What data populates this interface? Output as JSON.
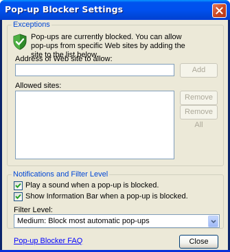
{
  "window": {
    "title": "Pop-up Blocker Settings",
    "titlebar_color": "#0054e3"
  },
  "exceptions": {
    "legend": "Exceptions",
    "description": "Pop-ups are currently blocked.  You can allow pop-ups from specific Web sites by adding the site to the list below.",
    "address_label": "Address of Web site to allow:",
    "address_value": "",
    "add_button": "Add",
    "allowed_sites_label": "Allowed sites:",
    "allowed_sites": [],
    "remove_button": "Remove",
    "remove_all_button": "Remove All"
  },
  "notifications": {
    "legend": "Notifications and Filter Level",
    "play_sound_label": "Play a sound when a pop-up is blocked.",
    "play_sound_checked": true,
    "info_bar_label": "Show Information Bar when a pop-up is blocked.",
    "info_bar_checked": true,
    "filter_level_label": "Filter Level:",
    "filter_level_value": "Medium: Block most automatic pop-ups"
  },
  "footer": {
    "faq_link": "Pop-up Blocker FAQ",
    "close_button": "Close"
  },
  "colors": {
    "accent": "#0046d5",
    "dialog_bg": "#ece9d8",
    "link": "#0000ff",
    "disabled_text": "#aca899"
  },
  "icons": {
    "shield": "shield-check-icon",
    "close": "close-icon",
    "dropdown": "chevron-down-icon",
    "checkmark": "checkmark-icon"
  }
}
